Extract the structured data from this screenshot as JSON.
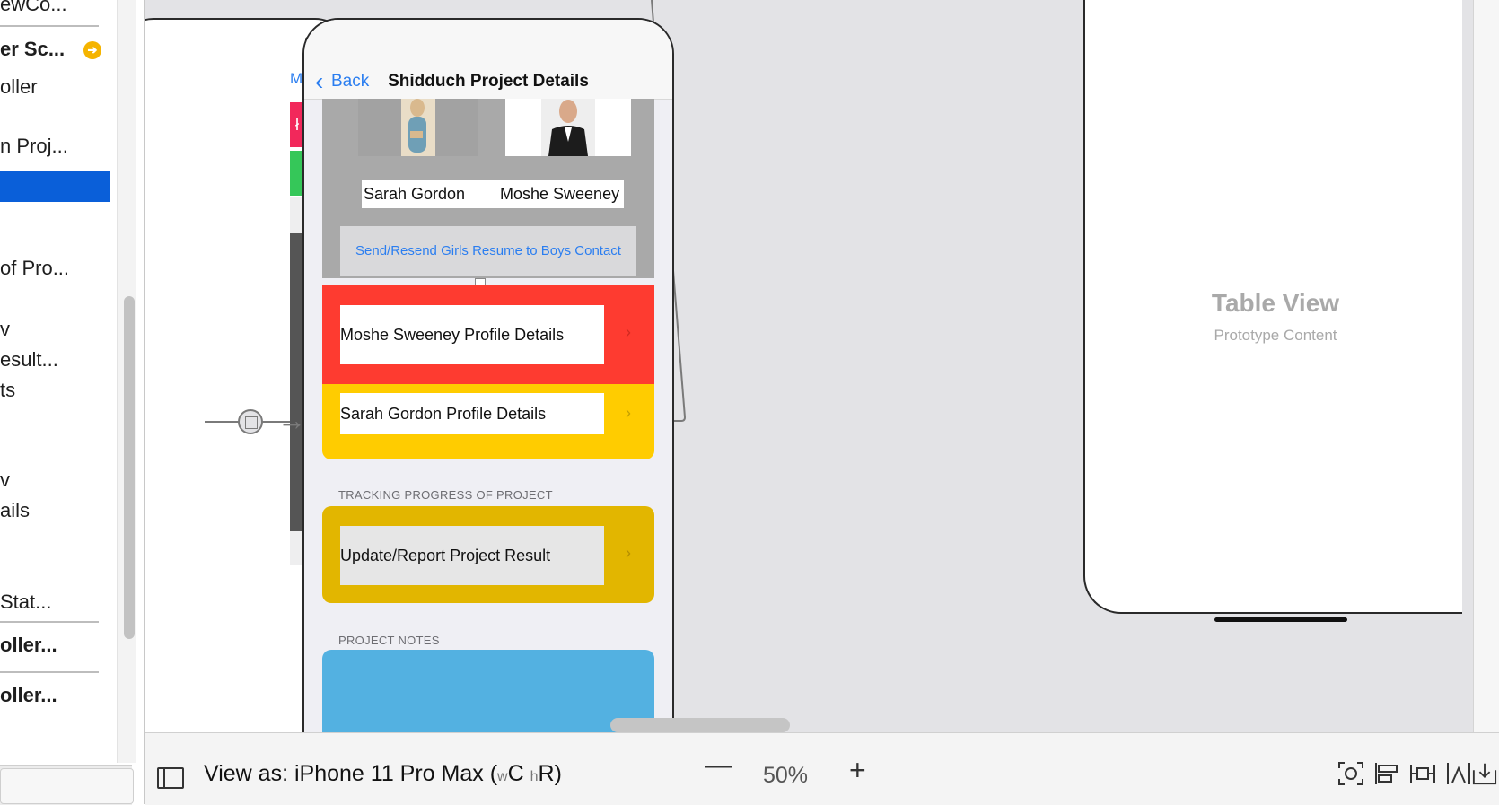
{
  "outline": {
    "items": [
      {
        "label": "ewCo...",
        "bold": false
      },
      {
        "label": "er Sc...",
        "bold": true
      },
      {
        "label": "oller",
        "bold": false
      },
      {
        "label": "n Proj...",
        "bold": false
      },
      {
        "label": "of Pro...",
        "bold": false
      },
      {
        "label": "v",
        "bold": false
      },
      {
        "label": "esult...",
        "bold": false
      },
      {
        "label": "ts",
        "bold": false
      },
      {
        "label": "v",
        "bold": false
      },
      {
        "label": "ails",
        "bold": false
      },
      {
        "label": "Stat...",
        "bold": false
      },
      {
        "label": "oller...",
        "bold": true
      },
      {
        "label": "oller...",
        "bold": true
      }
    ]
  },
  "left_scene": {
    "match_label": "Match",
    "no_button": "No"
  },
  "center_scene": {
    "back_label": "Back",
    "title": "Shidduch Project Details",
    "girl_name": "Sarah Gordon",
    "boy_name": "Moshe Sweeney",
    "send_button": "Send/Resend Girls Resume to Boys Contact",
    "cells": [
      {
        "label": "Moshe Sweeney Profile Details",
        "color": "#fe3b30"
      },
      {
        "label": "Sarah Gordon Profile Details",
        "color": "#ffcc00"
      }
    ],
    "tracking_header": "TRACKING PROGRESS OF PROJECT",
    "tracking_cell": {
      "label": "Update/Report Project Result",
      "color": "#e2b600"
    },
    "notes_header": "PROJECT NOTES",
    "notes_color": "#53b1e1"
  },
  "right_scene": {
    "table_title": "Table View",
    "table_subtitle": "Prototype Content"
  },
  "bottom_bar": {
    "view_as_prefix": "View as: iPhone 11 Pro Max (",
    "size_w": "w",
    "size_wc": "C",
    "size_h": "h",
    "size_hr": "R",
    "suffix": ")",
    "zoom": "50%"
  },
  "colors": {
    "canvas": "#e3e3e6",
    "selection": "#0a5fd9",
    "ios_blue": "#2b7ef0"
  }
}
